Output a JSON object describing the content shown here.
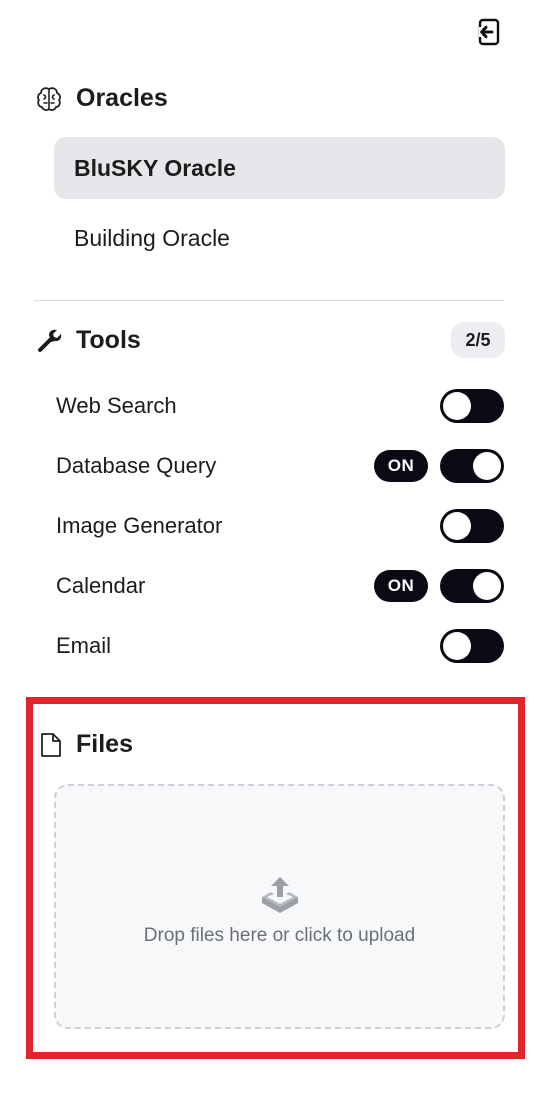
{
  "header": {
    "logout_icon": "logout-icon"
  },
  "oracles": {
    "title": "Oracles",
    "icon": "brain-icon",
    "items": [
      {
        "label": "BluSKY Oracle",
        "active": true
      },
      {
        "label": "Building Oracle",
        "active": false
      }
    ]
  },
  "tools": {
    "title": "Tools",
    "icon": "wrench-icon",
    "count": "2/5",
    "items": [
      {
        "label": "Web Search",
        "enabled": false,
        "badge": ""
      },
      {
        "label": "Database Query",
        "enabled": true,
        "badge": "ON"
      },
      {
        "label": "Image Generator",
        "enabled": false,
        "badge": ""
      },
      {
        "label": "Calendar",
        "enabled": true,
        "badge": "ON"
      },
      {
        "label": "Email",
        "enabled": false,
        "badge": ""
      }
    ]
  },
  "files": {
    "title": "Files",
    "icon": "file-icon",
    "dropzone_text": "Drop files here or click to upload",
    "upload_icon": "upload-icon"
  },
  "colors": {
    "toggle_bg": "#0a0a14",
    "active_item_bg": "#e6e7ea",
    "highlight_border": "#e0262c",
    "dropzone_bg": "#f7f8fa",
    "muted_text": "#6b6f78"
  }
}
